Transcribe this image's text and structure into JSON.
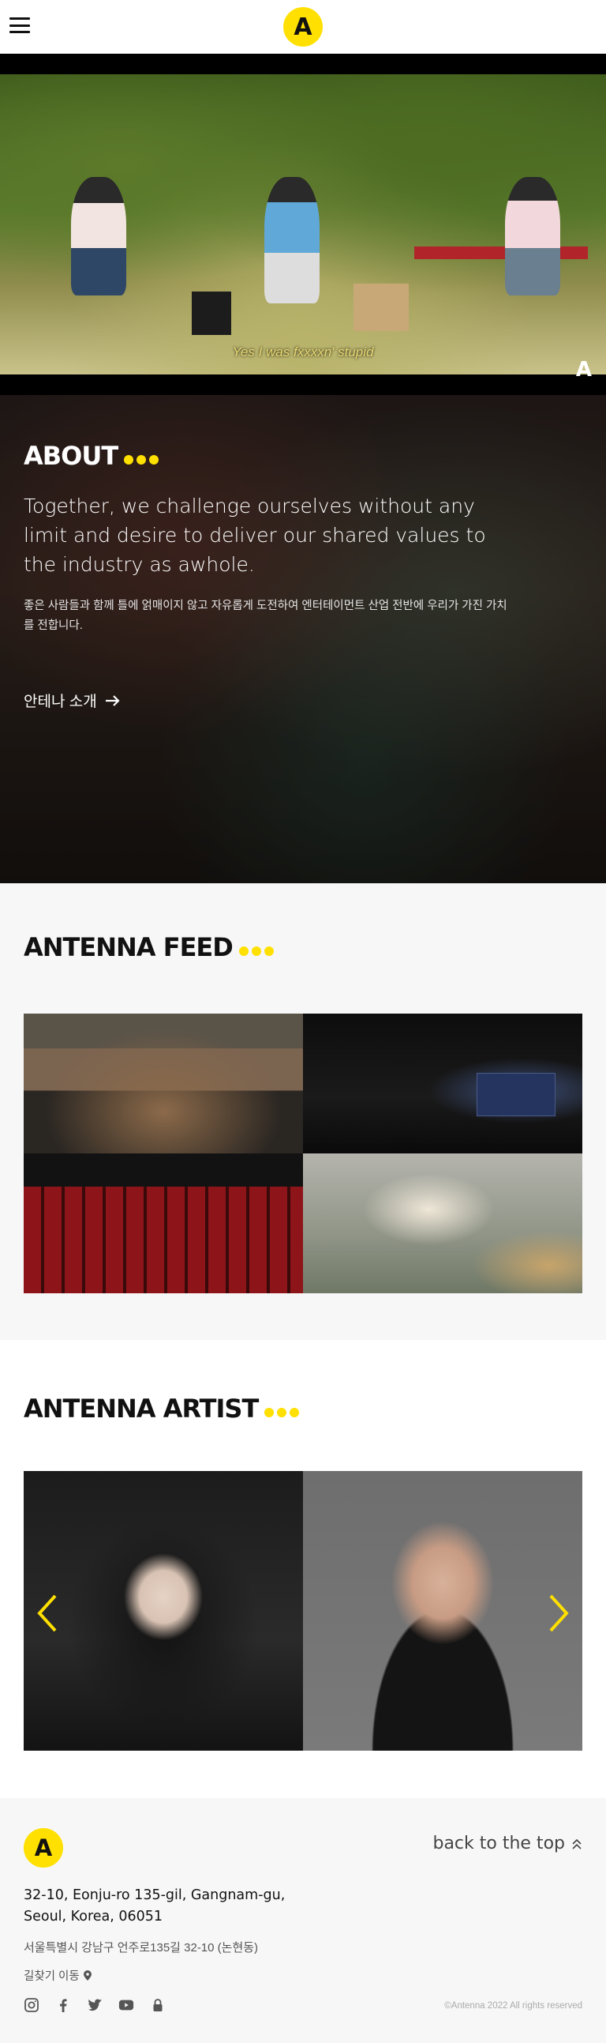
{
  "header": {
    "menu_icon": "hamburger-menu-icon",
    "logo_text": "A"
  },
  "hero": {
    "subtitle": "Yes I was fxxxxn' stupid",
    "watermark": "A"
  },
  "about": {
    "title": "ABOUT",
    "lead": "Together, we challenge ourselves without any limit and desire to deliver our shared values to the industry as awhole.",
    "korean": "좋은 사람들과 함께 틀에 얽매이지 않고 자유롭게 도전하여 엔터테이먼트 산업 전반에 우리가 가진 가치를 전합니다.",
    "link_label": "안테나 소개"
  },
  "feed": {
    "title": "ANTENNA FEED",
    "items": [
      {
        "name": "feed-concert-hall"
      },
      {
        "name": "feed-stage-screen"
      },
      {
        "name": "feed-theater-seats"
      },
      {
        "name": "feed-man-with-dog"
      }
    ]
  },
  "artist": {
    "title": "ANTENNA ARTIST",
    "prev_icon": "chevron-left-icon",
    "next_icon": "chevron-right-icon"
  },
  "footer": {
    "logo_text": "A",
    "back_to_top": "back to the top",
    "address_en_line1": "32-10, Eonju-ro 135-gil, Gangnam-gu,",
    "address_en_line2": "Seoul, Korea, 06051",
    "address_ko": "서울특별시 강남구 언주로135길 32-10 (논현동)",
    "directions": "길찾기 이동",
    "socials": [
      "instagram-icon",
      "facebook-icon",
      "twitter-icon",
      "youtube-icon",
      "lock-icon"
    ],
    "copyright": "©Antenna 2022 All rights reserved"
  },
  "colors": {
    "accent": "#FFE000",
    "text": "#111111",
    "footer_bg": "#F7F7F7"
  }
}
